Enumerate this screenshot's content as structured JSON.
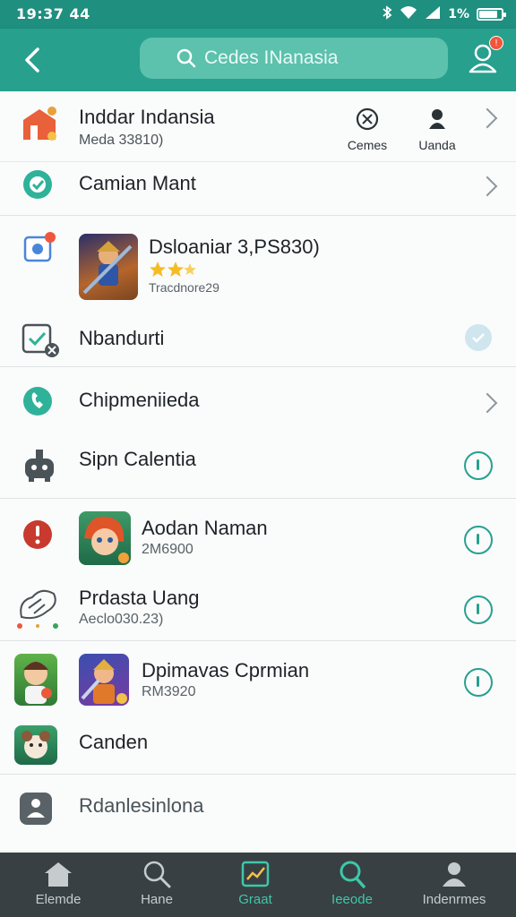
{
  "status_bar": {
    "time": "19:37 44",
    "battery": "1%"
  },
  "header": {
    "search_placeholder": "Cedes INanasia"
  },
  "top_card": {
    "title": "Inddar Indansia",
    "subtitle": "Meda 33810)",
    "quick_actions": [
      {
        "label": "Cemes",
        "icon": "gamepad-icon"
      },
      {
        "label": "Uanda",
        "icon": "person-icon"
      }
    ]
  },
  "rows": [
    {
      "title": "Camian Mant",
      "icon": "check-badge-icon"
    },
    {
      "title": "Dsloaniar 3,PS830)",
      "meta": "Tracdnore29",
      "rating": 2.5,
      "icon": "photo-icon"
    },
    {
      "title": "Nbandurti",
      "icon": "verified-check-icon"
    },
    {
      "title": "Chipmeniieda",
      "icon": "phone-icon"
    },
    {
      "title": "Sipn Calentia",
      "icon": "robot-icon"
    },
    {
      "title": "Aodan Naman",
      "meta": "2M6900",
      "icon": "alert-icon"
    },
    {
      "title": "Prdasta Uang",
      "meta": "Aeclo030.23)",
      "icon": "sketch-icon"
    },
    {
      "title": "Dpimavas Cprmian",
      "meta": "RM3920",
      "icon": "game-icon"
    },
    {
      "title": "Canden",
      "icon": "pet-icon"
    },
    {
      "title": "Rdanlesinlona",
      "icon": "bot-icon"
    }
  ],
  "bottom_nav": [
    {
      "label": "Elemde",
      "icon": "home-icon",
      "active": false
    },
    {
      "label": "Hane",
      "icon": "search-icon",
      "active": false
    },
    {
      "label": "Graat",
      "icon": "chart-icon",
      "active": true
    },
    {
      "label": "Ieeode",
      "icon": "search-icon",
      "active": true
    },
    {
      "label": "Indenrmes",
      "icon": "person-icon",
      "active": false
    }
  ],
  "colors": {
    "brand": "#27a08e",
    "brand_light": "#5cc1ad",
    "accent_red": "#f0563c",
    "nav_bg": "#384043",
    "nav_active": "#3ec7a9"
  }
}
